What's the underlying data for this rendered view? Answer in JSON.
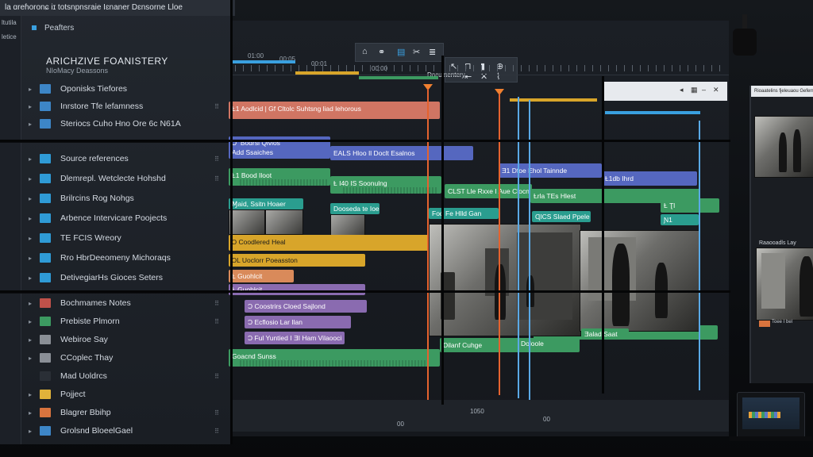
{
  "app": {
    "top_bar": "Ɩa ɑreɦoronɕ iɪ totsnpnsraie Iɛnaner Dɛnsorne Lloe",
    "side_labels": [
      "Ɩtutila",
      "Ɩetice"
    ]
  },
  "left_panel": {
    "header": "Peafters",
    "project_title": "ARICHZIVE FOANISTERY",
    "project_subtitle": "NIoMacy Deassons",
    "tree": [
      {
        "label": "Oponisks Tiefores",
        "color": "#3d86c7",
        "arrow": "▸",
        "grip": ""
      },
      {
        "label": "Inrstore Tfe lefamness",
        "color": "#3d86c7",
        "arrow": "▸",
        "grip": "⠿"
      },
      {
        "label": "Steriocs Cuho Hno Ore 6c N61A",
        "color": "#3d86c7",
        "arrow": "▸",
        "grip": ""
      }
    ],
    "assets": [
      {
        "label": "Source references",
        "color": "#2f9bd6",
        "arrow": "▸",
        "grip": "⠿"
      },
      {
        "label": "Dlemrepl. Wetclecte Hohshd",
        "color": "#2f9bd6",
        "arrow": "▸",
        "grip": "⠿"
      },
      {
        "label": "Brilrcins Rog Nohgs",
        "color": "#2f9bd6",
        "arrow": "▸",
        "grip": ""
      },
      {
        "label": "Arbence Intervicare Poojects",
        "color": "#2f9bd6",
        "arrow": "▸",
        "grip": ""
      },
      {
        "label": "TE FCIS Wreory",
        "color": "#2f9bd6",
        "arrow": "▸",
        "grip": ""
      },
      {
        "label": "Rro HbrDeeomeny Michoraqs",
        "color": "#2f9bd6",
        "arrow": "▸",
        "grip": ""
      },
      {
        "label": "DetivegiarHs Gioces Seters",
        "color": "#2f9bd6",
        "arrow": "▸",
        "grip": ""
      }
    ],
    "more": [
      {
        "label": "Bochmames Notes",
        "color": "#c0514a",
        "arrow": "▸",
        "grip": "⠿"
      },
      {
        "label": "Prebiste Plmorn",
        "color": "#3c9a61",
        "arrow": "▸",
        "grip": "⠿"
      },
      {
        "label": "Webiroe Say",
        "color": "#8a8f96",
        "arrow": "▸",
        "grip": ""
      },
      {
        "label": "CCoplec Thay",
        "color": "#8a8f96",
        "arrow": "▸",
        "grip": ""
      },
      {
        "label": "Mad Uoldrcs",
        "color": "#2a2f36",
        "arrow": "",
        "grip": "⠿"
      },
      {
        "label": "Pojject",
        "color": "#e0b23a",
        "arrow": "▸",
        "grip": ""
      },
      {
        "label": "Blagrer Bbihp",
        "color": "#d9743e",
        "arrow": "▸",
        "grip": "⠿"
      },
      {
        "label": "Grolsnd BloeelGael",
        "color": "#3d86c7",
        "arrow": "▸",
        "grip": "⠿"
      }
    ]
  },
  "timeline": {
    "timecodes_top": [
      "01:00",
      "00:05",
      "00:01",
      "00:00"
    ],
    "doc_label": "Documentery",
    "bottom_timecodes": [
      "00",
      "1050",
      "00"
    ],
    "clips": {
      "c1": "Ƚ1  Aodlcid | Gf Cltolc Suhtsng liad lehorous",
      "c2": "Ɔ  Bodrsi Qlvlos\nAdd Ssaiches",
      "c3": "EALS Hloo Il Doclt Esalnos",
      "c4": "Ǝ1 Dfoe Ehol Tainnde",
      "c5": "Ƚ1db Ihrd",
      "c6": "Ƚ1 Bood Iloot",
      "c7": "Ƚ I40  IS Soonulng",
      "c8": "CLST Lle Rxxe I Aue Clocnaghet",
      "c9": "Ƚrla TEs Hlest",
      "c10": "Ƚ Ʈl",
      "c11": "Ɱaid, Ssitn Hoaer",
      "c12": "Dooseda te Ioe",
      "c13": "Fod Fe Hlld Gan",
      "c14": "ɊICS Slaed Ppele",
      "c15": "Ɲ1",
      "c16": "Ɔ Coodlered Heal",
      "c17": "ƆL Uoclorr Poeasston",
      "c18": "Ƚ Guohlcit",
      "c19": "Ɔ Coostrirs Cloed Sajlond",
      "c20": "Ɔ Ecflosio Lar Ilan",
      "c21": "Ɔ Ful Yuntied I ƎI Ham Vilaooci",
      "c22": "Goacnd Sunss",
      "c23": "Dilanf Cuhge",
      "c24": "Conce Rlesr",
      "c25": "Doloole",
      "c26": "Ǝalad Saat"
    }
  },
  "right_monitor": {
    "title": "Rioaatelins fjeleuaou Gefernes",
    "label": "Raaooadls Lay",
    "button_label": "Toee I bel"
  },
  "colors": {
    "accent": "#3aa0e0",
    "playhead": "#e5632f",
    "green_clip": "#3c9a61",
    "blue_clip": "#5567bf",
    "yellow_clip": "#d8a52a",
    "purple_clip": "#8a6bb0"
  }
}
